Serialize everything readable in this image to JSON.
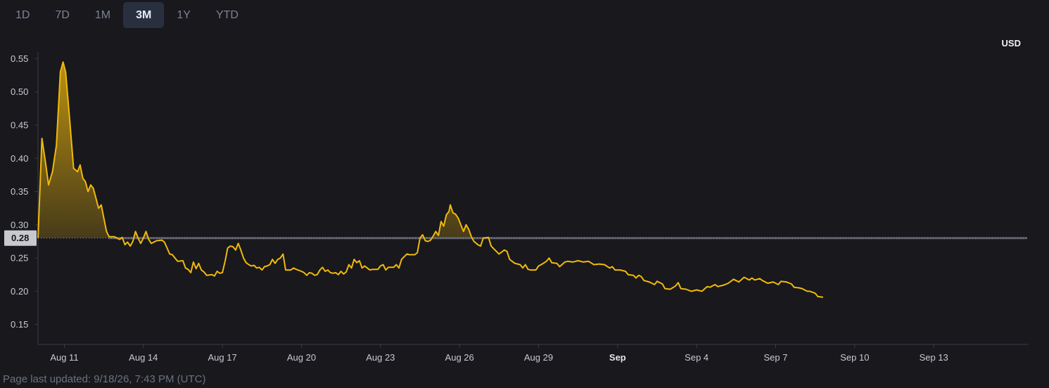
{
  "range_tabs": [
    {
      "label": "1D",
      "active": false
    },
    {
      "label": "7D",
      "active": false
    },
    {
      "label": "1M",
      "active": false
    },
    {
      "label": "3M",
      "active": true
    },
    {
      "label": "1Y",
      "active": false
    },
    {
      "label": "YTD",
      "active": false
    }
  ],
  "currency": "USD",
  "footer": "Page last updated: 9/18/26, 7:43 PM (UTC)",
  "chart_data": {
    "type": "area",
    "title": "",
    "xlabel": "",
    "ylabel": "",
    "x_start": "Aug 10",
    "x_range_days": [
      0,
      37.6
    ],
    "ylim": [
      0.12,
      0.56
    ],
    "y_ticks": [
      0.55,
      0.5,
      0.45,
      0.4,
      0.35,
      0.3,
      0.25,
      0.2,
      0.15
    ],
    "y_tick_labels": [
      "0.55",
      "0.50",
      "0.45",
      "0.40",
      "0.35",
      "0.30",
      "0.25",
      "0.20",
      "0.15"
    ],
    "x_ticks": [
      {
        "day": 1,
        "label": "Aug 11",
        "bold": false
      },
      {
        "day": 4,
        "label": "Aug 14",
        "bold": false
      },
      {
        "day": 7,
        "label": "Aug 17",
        "bold": false
      },
      {
        "day": 10,
        "label": "Aug 20",
        "bold": false
      },
      {
        "day": 13,
        "label": "Aug 23",
        "bold": false
      },
      {
        "day": 16,
        "label": "Aug 26",
        "bold": false
      },
      {
        "day": 19,
        "label": "Aug 29",
        "bold": false
      },
      {
        "day": 22,
        "label": "Sep",
        "bold": true
      },
      {
        "day": 25,
        "label": "Sep 4",
        "bold": false
      },
      {
        "day": 28,
        "label": "Sep 7",
        "bold": false
      },
      {
        "day": 31,
        "label": "Sep 10",
        "bold": false
      },
      {
        "day": 34,
        "label": "Sep 13",
        "bold": false
      }
    ],
    "baseline": {
      "value": 0.28,
      "label": "0.28"
    },
    "line_color": "#f0b90b",
    "grid": false,
    "series": [
      {
        "name": "",
        "points": [
          [
            0.0,
            0.28
          ],
          [
            0.15,
            0.43
          ],
          [
            0.3,
            0.39
          ],
          [
            0.4,
            0.36
          ],
          [
            0.55,
            0.38
          ],
          [
            0.7,
            0.42
          ],
          [
            0.85,
            0.53
          ],
          [
            0.95,
            0.545
          ],
          [
            1.05,
            0.53
          ],
          [
            1.2,
            0.46
          ],
          [
            1.35,
            0.385
          ],
          [
            1.5,
            0.38
          ],
          [
            1.6,
            0.39
          ],
          [
            1.7,
            0.37
          ],
          [
            1.8,
            0.365
          ],
          [
            1.9,
            0.35
          ],
          [
            2.0,
            0.36
          ],
          [
            2.1,
            0.355
          ],
          [
            2.2,
            0.34
          ],
          [
            2.3,
            0.325
          ],
          [
            2.4,
            0.33
          ],
          [
            2.5,
            0.31
          ],
          [
            2.6,
            0.29
          ],
          [
            2.7,
            0.282
          ],
          [
            2.9,
            0.282
          ],
          [
            3.1,
            0.278
          ],
          [
            3.2,
            0.281
          ],
          [
            3.3,
            0.27
          ],
          [
            3.4,
            0.274
          ],
          [
            3.5,
            0.268
          ],
          [
            3.6,
            0.275
          ],
          [
            3.7,
            0.29
          ],
          [
            3.8,
            0.28
          ],
          [
            3.9,
            0.272
          ],
          [
            4.0,
            0.28
          ],
          [
            4.1,
            0.29
          ],
          [
            4.2,
            0.278
          ],
          [
            4.3,
            0.272
          ],
          [
            4.5,
            0.276
          ],
          [
            4.7,
            0.277
          ],
          [
            4.8,
            0.274
          ],
          [
            4.9,
            0.265
          ],
          [
            5.0,
            0.256
          ],
          [
            5.1,
            0.255
          ],
          [
            5.2,
            0.25
          ],
          [
            5.3,
            0.245
          ],
          [
            5.5,
            0.246
          ],
          [
            5.6,
            0.235
          ],
          [
            5.7,
            0.233
          ],
          [
            5.8,
            0.228
          ],
          [
            5.9,
            0.244
          ],
          [
            6.0,
            0.234
          ],
          [
            6.1,
            0.242
          ],
          [
            6.2,
            0.232
          ],
          [
            6.3,
            0.229
          ],
          [
            6.4,
            0.224
          ],
          [
            6.6,
            0.225
          ],
          [
            6.7,
            0.223
          ],
          [
            6.8,
            0.23
          ],
          [
            6.9,
            0.227
          ],
          [
            7.0,
            0.228
          ],
          [
            7.1,
            0.245
          ],
          [
            7.2,
            0.265
          ],
          [
            7.3,
            0.268
          ],
          [
            7.4,
            0.267
          ],
          [
            7.5,
            0.262
          ],
          [
            7.6,
            0.272
          ],
          [
            7.7,
            0.262
          ],
          [
            7.8,
            0.25
          ],
          [
            7.9,
            0.243
          ],
          [
            8.0,
            0.24
          ],
          [
            8.1,
            0.238
          ],
          [
            8.2,
            0.239
          ],
          [
            8.3,
            0.235
          ],
          [
            8.4,
            0.236
          ],
          [
            8.5,
            0.232
          ],
          [
            8.6,
            0.237
          ],
          [
            8.7,
            0.238
          ],
          [
            8.8,
            0.24
          ],
          [
            8.9,
            0.248
          ],
          [
            9.0,
            0.242
          ],
          [
            9.1,
            0.248
          ],
          [
            9.2,
            0.25
          ],
          [
            9.3,
            0.256
          ],
          [
            9.4,
            0.232
          ],
          [
            9.6,
            0.232
          ],
          [
            9.7,
            0.235
          ],
          [
            9.8,
            0.233
          ],
          [
            10.0,
            0.23
          ],
          [
            10.1,
            0.228
          ],
          [
            10.2,
            0.224
          ],
          [
            10.3,
            0.228
          ],
          [
            10.4,
            0.227
          ],
          [
            10.5,
            0.224
          ],
          [
            10.6,
            0.225
          ],
          [
            10.7,
            0.232
          ],
          [
            10.8,
            0.236
          ],
          [
            10.9,
            0.23
          ],
          [
            11.0,
            0.232
          ],
          [
            11.1,
            0.228
          ],
          [
            11.2,
            0.227
          ],
          [
            11.3,
            0.228
          ],
          [
            11.4,
            0.225
          ],
          [
            11.5,
            0.23
          ],
          [
            11.6,
            0.226
          ],
          [
            11.7,
            0.229
          ],
          [
            11.8,
            0.24
          ],
          [
            11.9,
            0.235
          ],
          [
            12.0,
            0.248
          ],
          [
            12.1,
            0.243
          ],
          [
            12.2,
            0.246
          ],
          [
            12.3,
            0.235
          ],
          [
            12.4,
            0.238
          ],
          [
            12.5,
            0.235
          ],
          [
            12.6,
            0.232
          ],
          [
            12.7,
            0.233
          ],
          [
            12.9,
            0.233
          ],
          [
            13.0,
            0.238
          ],
          [
            13.1,
            0.24
          ],
          [
            13.2,
            0.232
          ],
          [
            13.3,
            0.236
          ],
          [
            13.5,
            0.236
          ],
          [
            13.6,
            0.24
          ],
          [
            13.7,
            0.235
          ],
          [
            13.8,
            0.248
          ],
          [
            13.9,
            0.252
          ],
          [
            14.0,
            0.256
          ],
          [
            14.1,
            0.255
          ],
          [
            14.3,
            0.255
          ],
          [
            14.4,
            0.258
          ],
          [
            14.5,
            0.28
          ],
          [
            14.6,
            0.285
          ],
          [
            14.7,
            0.276
          ],
          [
            14.8,
            0.275
          ],
          [
            14.9,
            0.277
          ],
          [
            15.0,
            0.283
          ],
          [
            15.1,
            0.29
          ],
          [
            15.2,
            0.284
          ],
          [
            15.3,
            0.305
          ],
          [
            15.4,
            0.298
          ],
          [
            15.5,
            0.315
          ],
          [
            15.6,
            0.32
          ],
          [
            15.65,
            0.33
          ],
          [
            15.75,
            0.318
          ],
          [
            15.85,
            0.316
          ],
          [
            15.95,
            0.31
          ],
          [
            16.05,
            0.3
          ],
          [
            16.15,
            0.29
          ],
          [
            16.25,
            0.3
          ],
          [
            16.35,
            0.293
          ],
          [
            16.45,
            0.282
          ],
          [
            16.55,
            0.275
          ],
          [
            16.7,
            0.27
          ],
          [
            16.8,
            0.268
          ],
          [
            16.9,
            0.28
          ],
          [
            17.1,
            0.281
          ],
          [
            17.2,
            0.268
          ],
          [
            17.3,
            0.264
          ],
          [
            17.5,
            0.256
          ],
          [
            17.6,
            0.259
          ],
          [
            17.7,
            0.262
          ],
          [
            17.8,
            0.26
          ],
          [
            17.9,
            0.248
          ],
          [
            18.0,
            0.245
          ],
          [
            18.1,
            0.242
          ],
          [
            18.3,
            0.24
          ],
          [
            18.4,
            0.235
          ],
          [
            18.5,
            0.24
          ],
          [
            18.6,
            0.233
          ],
          [
            18.7,
            0.232
          ],
          [
            18.9,
            0.232
          ],
          [
            19.0,
            0.238
          ],
          [
            19.1,
            0.24
          ],
          [
            19.3,
            0.245
          ],
          [
            19.4,
            0.25
          ],
          [
            19.5,
            0.243
          ],
          [
            19.7,
            0.242
          ],
          [
            19.8,
            0.237
          ],
          [
            20.0,
            0.244
          ],
          [
            20.1,
            0.245
          ],
          [
            20.3,
            0.244
          ],
          [
            20.5,
            0.246
          ],
          [
            20.7,
            0.244
          ],
          [
            20.9,
            0.245
          ],
          [
            21.1,
            0.24
          ],
          [
            21.3,
            0.241
          ],
          [
            21.5,
            0.24
          ],
          [
            21.7,
            0.235
          ],
          [
            21.8,
            0.237
          ],
          [
            21.9,
            0.232
          ],
          [
            22.1,
            0.232
          ],
          [
            22.3,
            0.23
          ],
          [
            22.4,
            0.225
          ],
          [
            22.6,
            0.224
          ],
          [
            22.7,
            0.22
          ],
          [
            22.8,
            0.224
          ],
          [
            22.9,
            0.222
          ],
          [
            23.0,
            0.216
          ],
          [
            23.2,
            0.214
          ],
          [
            23.4,
            0.21
          ],
          [
            23.5,
            0.215
          ],
          [
            23.7,
            0.211
          ],
          [
            23.8,
            0.204
          ],
          [
            24.0,
            0.203
          ],
          [
            24.2,
            0.208
          ],
          [
            24.3,
            0.213
          ],
          [
            24.4,
            0.204
          ],
          [
            24.6,
            0.203
          ],
          [
            24.8,
            0.2
          ],
          [
            25.0,
            0.202
          ],
          [
            25.2,
            0.2
          ],
          [
            25.4,
            0.207
          ],
          [
            25.5,
            0.206
          ],
          [
            25.7,
            0.21
          ],
          [
            25.8,
            0.207
          ],
          [
            26.0,
            0.209
          ],
          [
            26.2,
            0.212
          ],
          [
            26.4,
            0.218
          ],
          [
            26.5,
            0.216
          ],
          [
            26.6,
            0.214
          ],
          [
            26.8,
            0.221
          ],
          [
            27.0,
            0.217
          ],
          [
            27.1,
            0.22
          ],
          [
            27.2,
            0.217
          ],
          [
            27.4,
            0.219
          ],
          [
            27.5,
            0.216
          ],
          [
            27.7,
            0.212
          ],
          [
            27.9,
            0.214
          ],
          [
            28.1,
            0.21
          ],
          [
            28.2,
            0.215
          ],
          [
            28.4,
            0.214
          ],
          [
            28.6,
            0.211
          ],
          [
            28.7,
            0.206
          ],
          [
            28.9,
            0.205
          ],
          [
            29.0,
            0.204
          ],
          [
            29.2,
            0.2
          ],
          [
            29.3,
            0.2
          ],
          [
            29.5,
            0.197
          ],
          [
            29.6,
            0.192
          ],
          [
            29.8,
            0.191
          ]
        ]
      }
    ]
  }
}
